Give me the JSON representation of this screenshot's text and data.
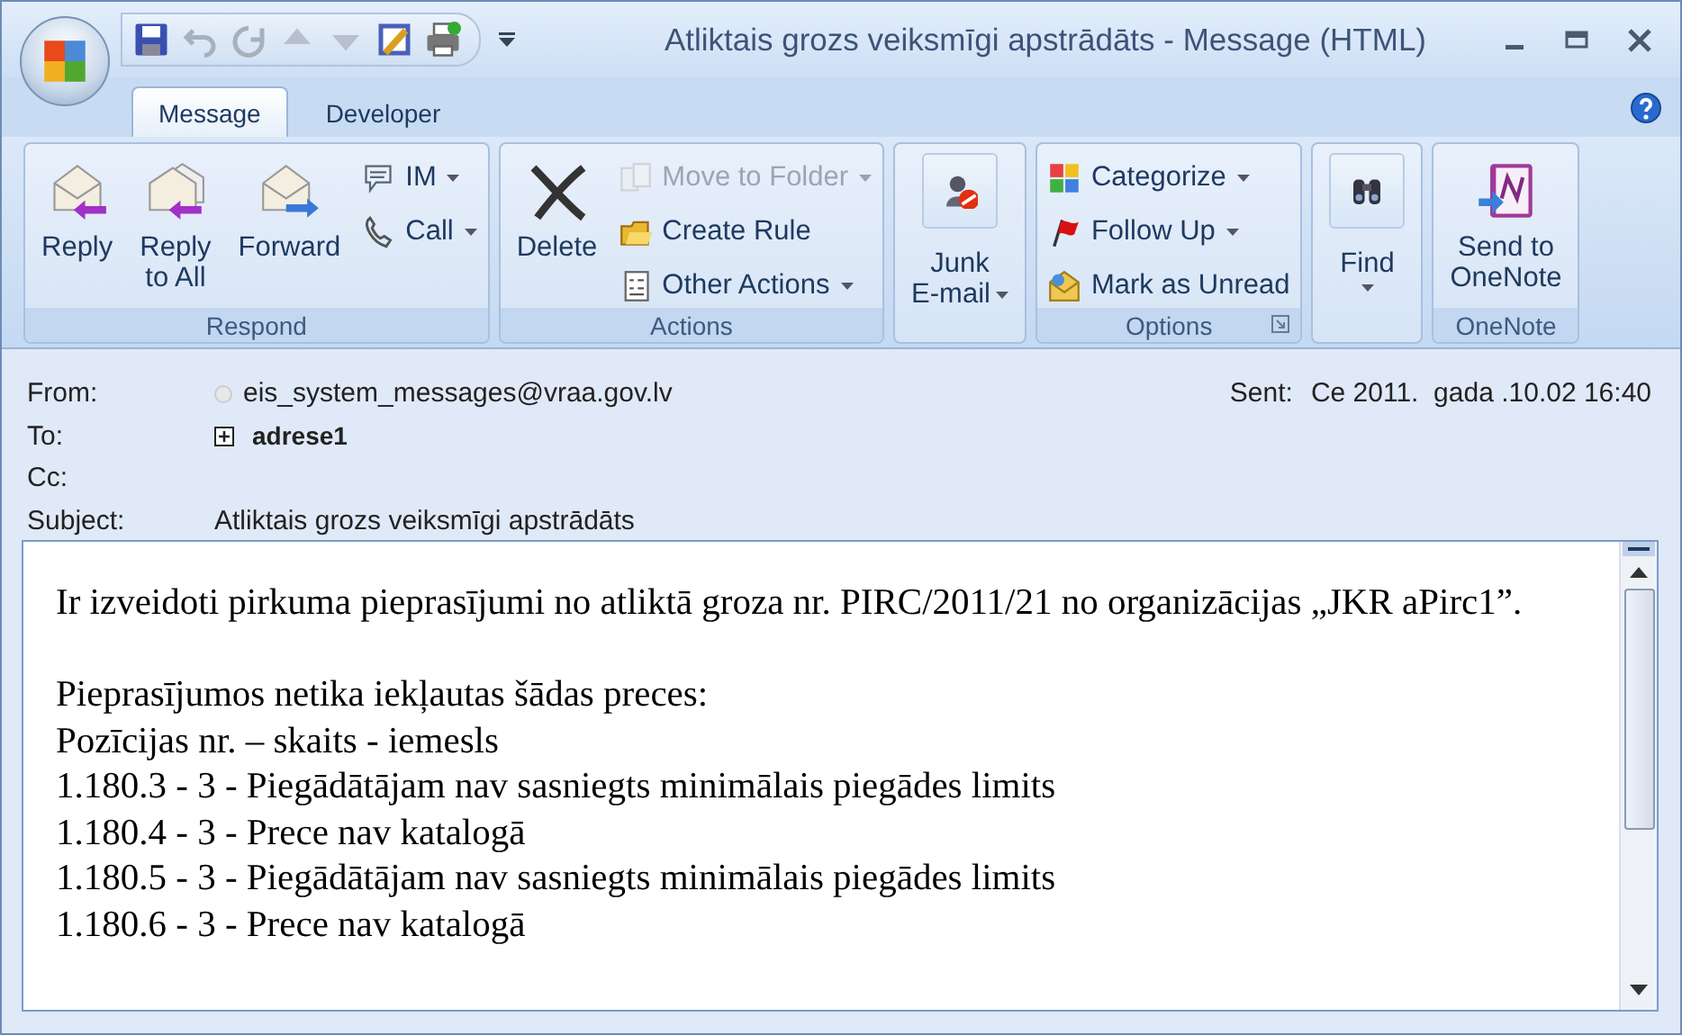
{
  "window": {
    "title": "Atliktais grozs veiksmīgi apstrādāts - Message (HTML)"
  },
  "tabs": [
    {
      "label": "Message",
      "selected": true
    },
    {
      "label": "Developer",
      "selected": false
    }
  ],
  "ribbon": {
    "groups": [
      {
        "label": "Respond",
        "buttons": [
          {
            "label": "Reply",
            "kind": "large",
            "dropdown": false,
            "disabled": false
          },
          {
            "label": "Reply\nto All",
            "kind": "large",
            "dropdown": false,
            "disabled": false
          },
          {
            "label": "Forward",
            "kind": "large",
            "dropdown": false,
            "disabled": false
          },
          {
            "label": "IM",
            "kind": "small",
            "dropdown": true,
            "disabled": false
          },
          {
            "label": "Call",
            "kind": "small",
            "dropdown": true,
            "disabled": false
          }
        ]
      },
      {
        "label": "Actions",
        "buttons": [
          {
            "label": "Delete",
            "kind": "large",
            "dropdown": false,
            "disabled": false
          },
          {
            "label": "Move to Folder",
            "kind": "small",
            "dropdown": true,
            "disabled": true
          },
          {
            "label": "Create Rule",
            "kind": "small",
            "dropdown": false,
            "disabled": false
          },
          {
            "label": "Other Actions",
            "kind": "small",
            "dropdown": true,
            "disabled": false
          }
        ]
      },
      {
        "buttons": [
          {
            "label": "Junk\nE-mail",
            "kind": "boxed",
            "dropdown": true,
            "disabled": false
          }
        ]
      },
      {
        "label": "Options",
        "dialog_launcher": true,
        "buttons": [
          {
            "label": "Categorize",
            "kind": "small",
            "dropdown": true,
            "disabled": false
          },
          {
            "label": "Follow Up",
            "kind": "small",
            "dropdown": true,
            "disabled": false
          },
          {
            "label": "Mark as Unread",
            "kind": "small",
            "dropdown": false,
            "disabled": false
          }
        ]
      },
      {
        "buttons": [
          {
            "label": "Find",
            "kind": "boxed",
            "dropdown": true,
            "disabled": false
          }
        ]
      },
      {
        "label": "OneNote",
        "buttons": [
          {
            "label": "Send to\nOneNote",
            "kind": "large",
            "dropdown": false,
            "disabled": false
          }
        ]
      }
    ]
  },
  "header": {
    "fields": [
      {
        "label": "From:",
        "value": "eis_system_messages@vraa.gov.lv",
        "kind": "sender"
      },
      {
        "label": "To:",
        "value": "adrese1",
        "kind": "group"
      },
      {
        "label": "Cc:",
        "kind": "plain"
      },
      {
        "label": "Subject:",
        "value": "Atliktais grozs veiksmīgi apstrādāts",
        "kind": "plain"
      }
    ],
    "sent": {
      "label": "Sent:",
      "value": "Ce 2011.  gada .10.02 16:40"
    }
  },
  "body": {
    "paragraphs": [
      [
        "Ir izveidoti pirkuma pieprasījumi no atliktā groza nr. PIRC/2011/21 no organizācijas „JKR aPirc1”."
      ],
      [
        "Pieprasījumos netika iekļautas šādas preces:",
        "Pozīcijas nr. – skaits - iemesls",
        "1.180.3 - 3 - Piegādātājam nav sasniegts minimālais piegādes limits",
        "1.180.4 - 3 - Prece nav katalogā",
        "1.180.5 - 3 - Piegādātājam nav sasniegts minimālais piegādes limits",
        "1.180.6 - 3 - Prece nav katalogā"
      ]
    ]
  }
}
